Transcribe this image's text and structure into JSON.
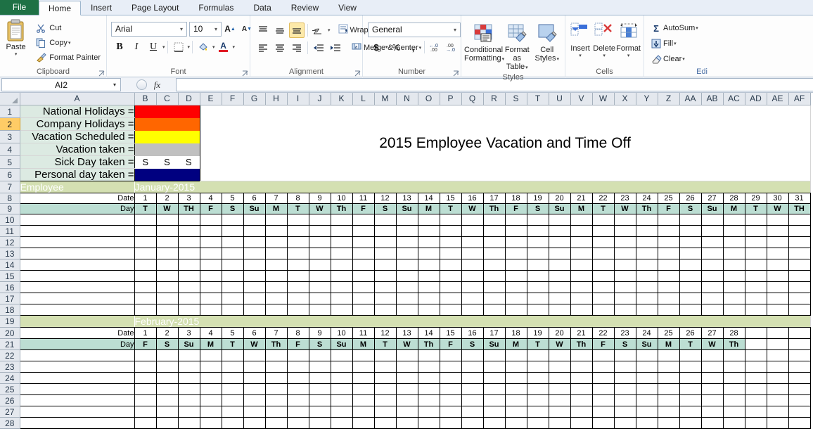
{
  "window": {
    "tabs": [
      "File",
      "Home",
      "Insert",
      "Page Layout",
      "Formulas",
      "Data",
      "Review",
      "View"
    ],
    "active_tab": "Home"
  },
  "ribbon": {
    "clipboard": {
      "label": "Clipboard",
      "paste": "Paste",
      "items": [
        "Cut",
        "Copy",
        "Format Painter"
      ]
    },
    "font": {
      "label": "Font",
      "font_name": "Arial",
      "font_size": "10",
      "grow": "A",
      "shrink": "A",
      "bold": "B",
      "italic": "I",
      "underline": "U"
    },
    "alignment": {
      "label": "Alignment",
      "wrap_text": "Wrap Text",
      "merge_center": "Merge & Center"
    },
    "number": {
      "label": "Number",
      "format": "General",
      "currency": "$",
      "percent": "%",
      "comma": ",",
      "inc_dec": ".00",
      "dec_dec": ".00"
    },
    "styles": {
      "label": "Styles",
      "conditional_formatting": "Conditional\nFormatting",
      "conditional_formatting_l1": "Conditional",
      "conditional_formatting_l2": "Formatting",
      "format_as_table_l1": "Format",
      "format_as_table_l2": "as Table",
      "cell_styles_l1": "Cell",
      "cell_styles_l2": "Styles"
    },
    "cells": {
      "label": "Cells",
      "insert": "Insert",
      "delete": "Delete",
      "format": "Format"
    },
    "editing": {
      "label": "Edi",
      "autosum": "AutoSum",
      "fill": "Fill",
      "clear": "Clear"
    }
  },
  "formula_bar": {
    "name_box": "AI2",
    "fx": "fx",
    "formula": ""
  },
  "sheet": {
    "columns": [
      "A",
      "B",
      "C",
      "D",
      "E",
      "F",
      "G",
      "H",
      "I",
      "J",
      "K",
      "L",
      "M",
      "N",
      "O",
      "P",
      "Q",
      "R",
      "S",
      "T",
      "U",
      "V",
      "W",
      "X",
      "Y",
      "Z",
      "AA",
      "AB",
      "AC",
      "AD",
      "AE",
      "AF"
    ],
    "rows": [
      1,
      2,
      3,
      4,
      5,
      6,
      7,
      8,
      9,
      10,
      11,
      12,
      13,
      14,
      15,
      16,
      17,
      18,
      19,
      20,
      21,
      22,
      23,
      24,
      25,
      26,
      27,
      28
    ],
    "selected_row": 2,
    "title": "2015 Employee Vacation and Time Off",
    "legend": [
      {
        "label": "National Holidays =",
        "color": "#FF0000",
        "text": ""
      },
      {
        "label": "Company Holidays =",
        "color": "#FF6600",
        "text": ""
      },
      {
        "label": "Vacation Scheduled =",
        "color": "#FFFF00",
        "text": ""
      },
      {
        "label": "Vacation taken =",
        "color": "#C0C0C0",
        "text": ""
      },
      {
        "label": "Sick Day taken =",
        "color": "#FFFFFF",
        "text": "S"
      },
      {
        "label": "Personal day taken =",
        "color": "#000080",
        "text": ""
      }
    ],
    "employee_header": "Employee",
    "date_label": "Date",
    "day_label": "Day",
    "months": [
      {
        "name": "January-2015",
        "dates": [
          1,
          2,
          3,
          4,
          5,
          6,
          7,
          8,
          9,
          10,
          11,
          12,
          13,
          14,
          15,
          16,
          17,
          18,
          19,
          20,
          21,
          22,
          23,
          24,
          25,
          26,
          27,
          28,
          29,
          30,
          31
        ],
        "days": [
          "T",
          "W",
          "TH",
          "F",
          "S",
          "Su",
          "M",
          "T",
          "W",
          "Th",
          "F",
          "S",
          "Su",
          "M",
          "T",
          "W",
          "Th",
          "F",
          "S",
          "Su",
          "M",
          "T",
          "W",
          "Th",
          "F",
          "S",
          "Su",
          "M",
          "T",
          "W",
          "TH"
        ]
      },
      {
        "name": "February-2015",
        "dates": [
          1,
          2,
          3,
          4,
          5,
          6,
          7,
          8,
          9,
          10,
          11,
          12,
          13,
          14,
          15,
          16,
          17,
          18,
          19,
          20,
          21,
          22,
          23,
          24,
          25,
          26,
          27,
          28
        ],
        "days": [
          "F",
          "S",
          "Su",
          "M",
          "T",
          "W",
          "Th",
          "F",
          "S",
          "Su",
          "M",
          "T",
          "W",
          "Th",
          "F",
          "S",
          "Su",
          "M",
          "T",
          "W",
          "Th",
          "F",
          "S",
          "Su",
          "M",
          "T",
          "W",
          "Th"
        ]
      }
    ]
  },
  "colors": {
    "legend_label_bg": "#DCEAE2",
    "month_header_bg": "#D4E0B2",
    "day_row_bg": "#BCDED3",
    "selection": "#FFCC66",
    "file_tab": "#1E7145"
  }
}
